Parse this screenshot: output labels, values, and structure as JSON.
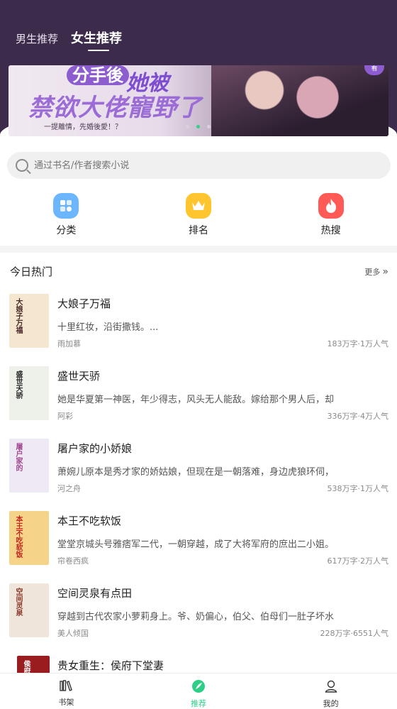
{
  "tabs": [
    {
      "label": "男生推荐"
    },
    {
      "label": "女生推荐"
    }
  ],
  "banner": {
    "title_part_a": "分手後",
    "title_part_b": "她被",
    "title_part_c": "禁欲大佬寵野了",
    "subtitle": "一提離情，先婚後愛！？",
    "badge": "看",
    "dots_total": 3,
    "dots_active_index": 1
  },
  "search": {
    "placeholder": "通过书名/作者搜索小说"
  },
  "quick": [
    {
      "label": "分类",
      "icon": "grid-icon",
      "color": "#6cb6ff"
    },
    {
      "label": "排名",
      "icon": "crown-icon",
      "color": "#ffc52e"
    },
    {
      "label": "热搜",
      "icon": "flame-icon",
      "color": "#ff5a55"
    }
  ],
  "section": {
    "title": "今日热门",
    "more": "更多"
  },
  "books": [
    {
      "title": "大娘子万福",
      "desc": "十里红妆，沿街撒钱。...",
      "author": "雨加慕",
      "stats": "183万字·1万人气",
      "cover_text": "大娘子万福",
      "cover_bg": "#f4e6cf"
    },
    {
      "title": "盛世天骄",
      "desc": "她是华夏第一神医，年少得志，风头无人能敌。嫁给那个男人后，却",
      "author": "阿彩",
      "stats": "336万字·4万人气",
      "cover_text": "盛世天骄",
      "cover_bg": "#eef0ea"
    },
    {
      "title": "屠户家的小娇娘",
      "desc": "萧婉儿原本是秀才家的娇姑娘，但现在是一朝落难，身边虎狼环伺，",
      "author": "河之舟",
      "stats": "538万字·1万人气",
      "cover_text": "屠户家的",
      "cover_bg": "#efe9f5"
    },
    {
      "title": "本王不吃软饭",
      "desc": "堂堂京城头号雅痞军二代，一朝穿越，成了大将军府的庶出二小姐。",
      "author": "帘卷西疯",
      "stats": "617万字·2万人气",
      "cover_text": "本王不吃软饭",
      "cover_bg": "#f5d48a"
    },
    {
      "title": "空间灵泉有点田",
      "desc": "穿越到古代农家小萝莉身上。爷、奶偏心，伯父、伯母们一肚子坏水",
      "author": "美人倾国",
      "stats": "228万字·6551人气",
      "cover_text": "空间灵泉",
      "cover_bg": "#efe5da"
    },
    {
      "title": "贵女重生：侯府下堂妻",
      "desc": "",
      "author": "",
      "stats": "",
      "cover_text": "侯府",
      "cover_bg": "#9b1c1f"
    }
  ],
  "bottom_nav": [
    {
      "label": "书架",
      "icon": "bookshelf-icon"
    },
    {
      "label": "推荐",
      "icon": "feather-icon",
      "active": true
    },
    {
      "label": "我的",
      "icon": "user-icon"
    }
  ],
  "colors": {
    "header_bg": "#3c2b4a",
    "accent": "#2dcf88"
  }
}
